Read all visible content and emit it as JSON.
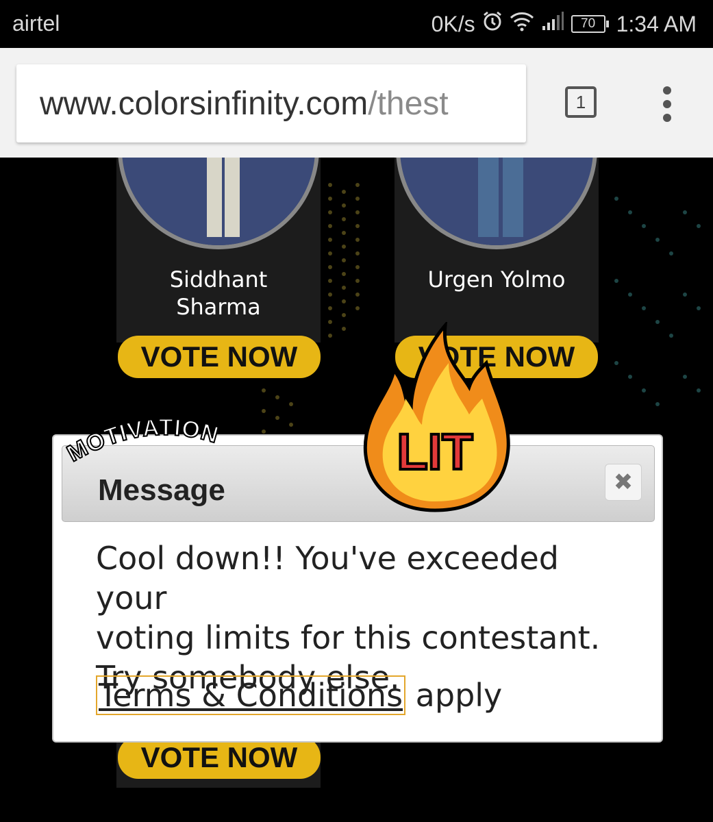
{
  "status_bar": {
    "carrier": "airtel",
    "net_speed": "0K/s",
    "battery": "70",
    "time": "1:34 AM"
  },
  "browser": {
    "url_domain": "www.colorsinfinity.com",
    "url_path": "/thest",
    "tab_count": "1"
  },
  "contestants": [
    {
      "name_line1": "Siddhant",
      "name_line2": "Sharma",
      "vote_label": "VOTE NOW"
    },
    {
      "name_line1": "Urgen Yolmo",
      "name_line2": "",
      "vote_label": "VOTE NOW"
    }
  ],
  "bottom_vote_label": "VOTE NOW",
  "modal": {
    "title": "Message",
    "close_glyph": "✖",
    "body_line1": "Cool down!! You've exceeded your",
    "body_line2": "voting limits for this contestant.",
    "body_line3": "Try somebody else.",
    "terms_link": "Terms & Conditions",
    "terms_suffix": " apply"
  },
  "stickers": {
    "motivation": "MOTIVATION",
    "lit": "LIT"
  },
  "colors": {
    "vote_button": "#e7b615",
    "card_bg": "#1c1c1c",
    "terms_outline": "#e3a62b"
  }
}
